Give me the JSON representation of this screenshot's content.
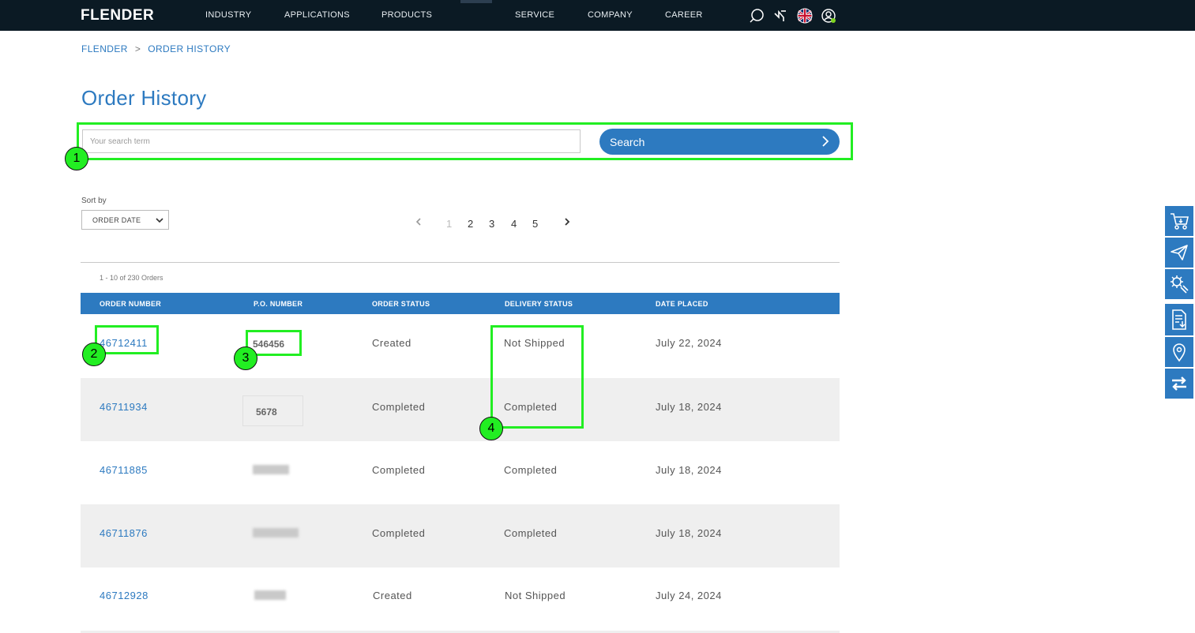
{
  "nav": {
    "logo": "FLENDER",
    "items": [
      "INDUSTRY",
      "APPLICATIONS",
      "PRODUCTS",
      "SERVICE",
      "COMPANY",
      "CAREER"
    ]
  },
  "breadcrumb": {
    "home": "FLENDER",
    "separator": ">",
    "current": "ORDER HISTORY"
  },
  "page_title": "Order History",
  "search": {
    "placeholder": "Your search term",
    "button_label": "Search"
  },
  "sort": {
    "label": "Sort by",
    "selected": "ORDER DATE"
  },
  "pagination": {
    "pages": [
      "1",
      "2",
      "3",
      "4",
      "5"
    ],
    "current": "1"
  },
  "results_count": "1 - 10 of 230 Orders",
  "table": {
    "headers": [
      "ORDER NUMBER",
      "P.O. NUMBER",
      "ORDER STATUS",
      "DELIVERY STATUS",
      "DATE PLACED"
    ],
    "rows": [
      {
        "order": "46712411",
        "po": "546456",
        "status": "Created",
        "delivery": "Not Shipped",
        "date": "July 22, 2024"
      },
      {
        "order": "46711934",
        "po": "5678",
        "status": "Completed",
        "delivery": "Completed",
        "date": "July 18, 2024"
      },
      {
        "order": "46711885",
        "po": "",
        "status": "Completed",
        "delivery": "Completed",
        "date": "July 18, 2024"
      },
      {
        "order": "46711876",
        "po": "",
        "status": "Completed",
        "delivery": "Completed",
        "date": "July 18, 2024"
      },
      {
        "order": "46712928",
        "po": "",
        "status": "Created",
        "delivery": "Not Shipped",
        "date": "July 24, 2024"
      }
    ]
  },
  "annotations": [
    "1",
    "2",
    "3",
    "4"
  ],
  "colors": {
    "brand_blue": "#2d7ac0",
    "nav_bg": "#0b1a24",
    "highlight": "#22ee22",
    "row_alt": "#efefef"
  },
  "icons": [
    "search-icon",
    "flender-signal-icon",
    "uk-flag-icon",
    "user-account-icon",
    "cart-icon",
    "send-icon",
    "service-tools-icon",
    "document-download-icon",
    "location-pin-icon",
    "exchange-icon"
  ]
}
